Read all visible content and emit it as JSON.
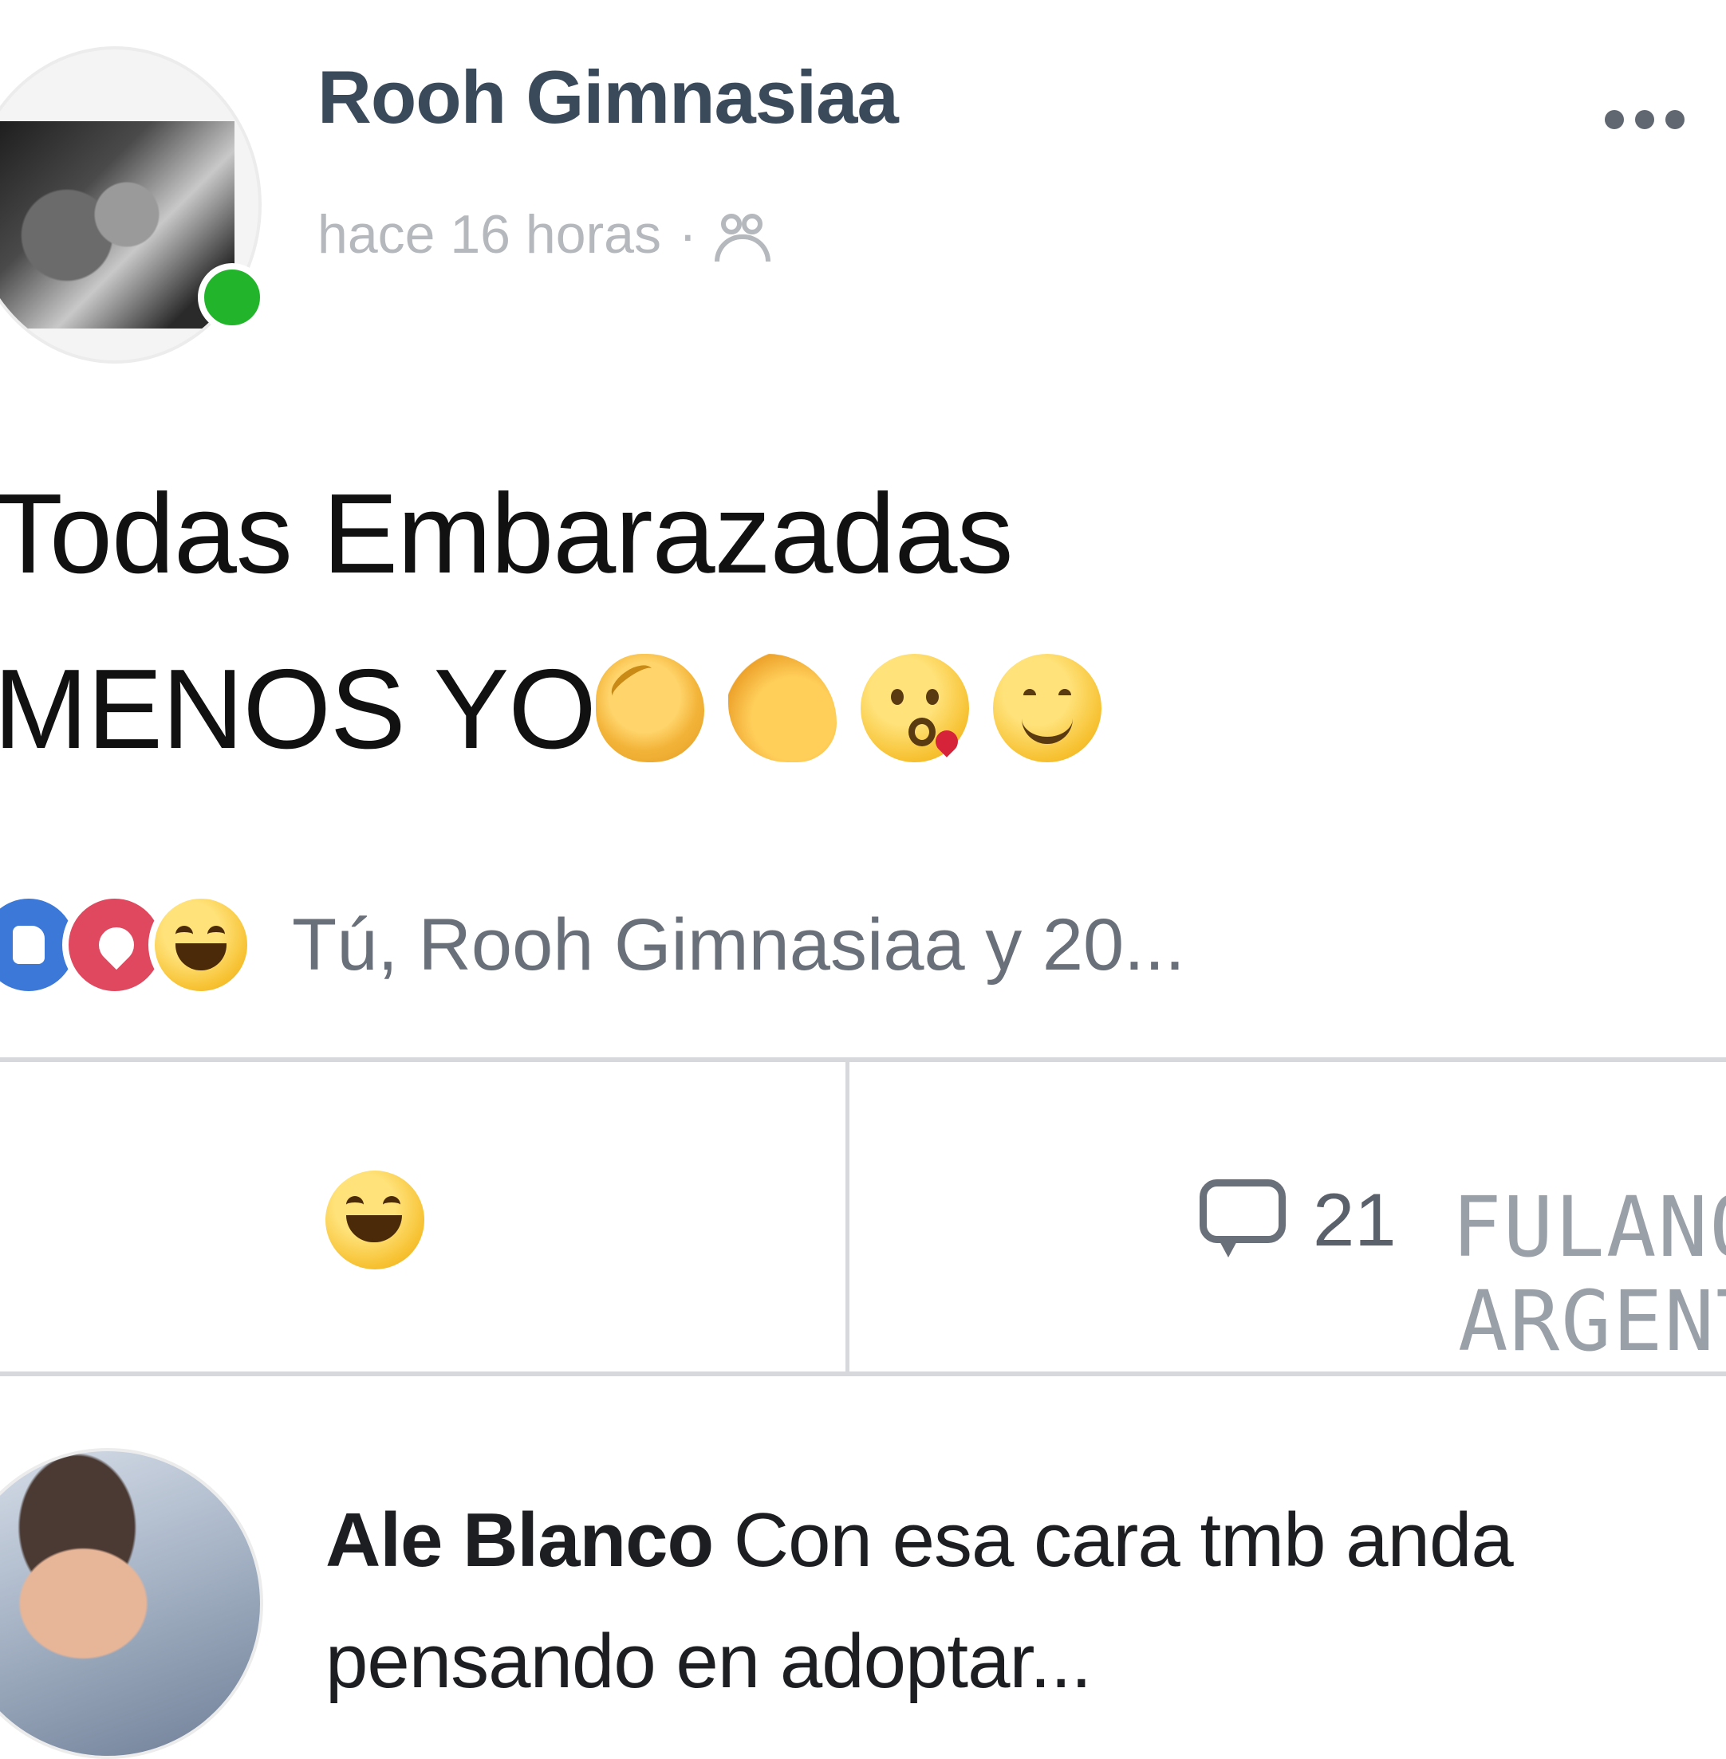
{
  "post": {
    "author": "Rooh Gimnasiaa",
    "time": "hace 16 horas",
    "separator": "·",
    "audience_icon": "friends-icon",
    "more_icon": "more-options-icon",
    "text_line1": "Todas Embarazadas",
    "text_line2": "MENOS YO",
    "emojis": [
      "clapping-hands-emoji",
      "flexed-biceps-emoji",
      "face-blowing-kiss-emoji",
      "smiling-face-emoji"
    ],
    "online": true
  },
  "reactions": {
    "icons": [
      "like-reaction",
      "love-reaction",
      "haha-reaction"
    ],
    "summary": "Tú, Rooh Gimnasiaa y 20..."
  },
  "actions": {
    "reaction_icon": "haha-reaction",
    "comment_icon": "comment-icon",
    "comment_count": "21"
  },
  "watermark": {
    "line1": "FULANO",
    "line2": "ARGENTI"
  },
  "comment": {
    "author": "Ale Blanco",
    "text": " Con esa cara tmb anda pensando en adoptar..."
  },
  "colors": {
    "author_name": "#3b4a5a",
    "meta_gray": "#b5b8bd",
    "online_green": "#22b52c",
    "like_blue": "#3b78d8",
    "love_red": "#e0485f",
    "divider": "#d6d8dc"
  }
}
